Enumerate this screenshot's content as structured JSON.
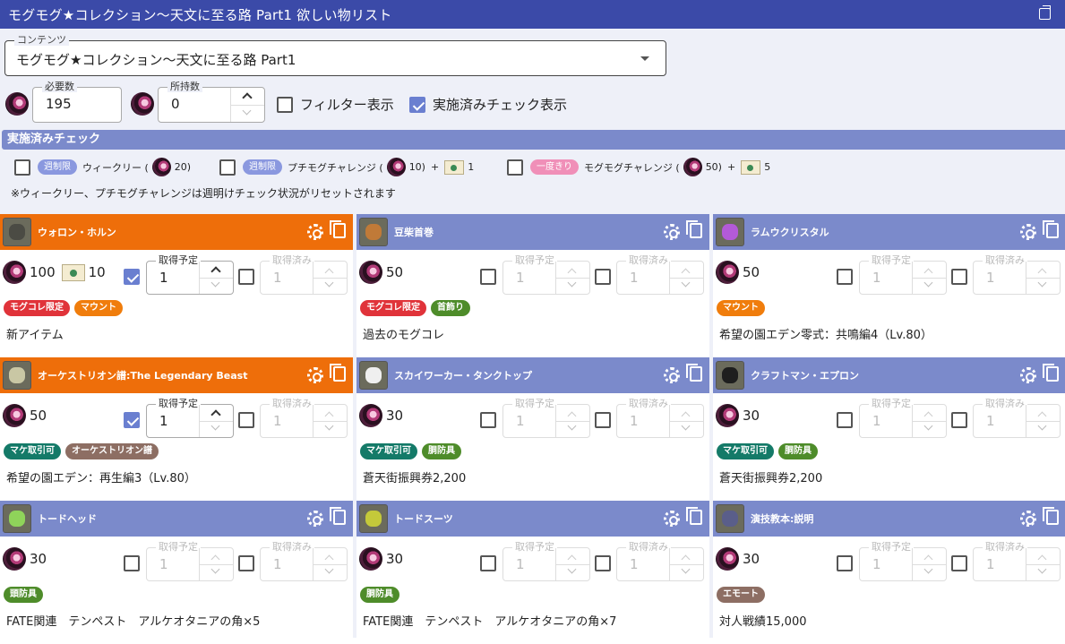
{
  "window": {
    "title": "モグモグ★コレクション～天文に至る路 Part1 欲しい物リスト"
  },
  "content_select": {
    "legend": "コンテンツ",
    "value": "モグモグ★コレクション～天文に至る路 Part1"
  },
  "required": {
    "legend": "必要数",
    "value": "195"
  },
  "owned": {
    "legend": "所持数",
    "value": "0"
  },
  "filter_toggle": {
    "label": "フィルター表示",
    "checked": false
  },
  "done_check_toggle": {
    "label": "実施済みチェック表示",
    "checked": true
  },
  "section_title": "実施済みチェック",
  "checks": [
    {
      "badge": "週制限",
      "label": "ウィークリー (",
      "tokens": "20)",
      "checked": false
    },
    {
      "badge": "週制限",
      "label": "プチモグチャレンジ (",
      "tokens": "10)",
      "plus": "+",
      "mail": "1",
      "checked": false
    },
    {
      "badge": "一度きり",
      "label": "モグモグチャレンジ (",
      "tokens": "50)",
      "plus": "+",
      "mail": "5",
      "checked": false
    }
  ],
  "note": "※ウィークリー、プチモグチャレンジは週明けチェック状況がリセットされます",
  "field_labels": {
    "planned": "取得予定",
    "obtained": "取得済み"
  },
  "items": [
    {
      "name": "ウォロン・ホルン",
      "tokens": "100",
      "mail": "10",
      "planned_checked": true,
      "planned": "1",
      "obtained": "1",
      "tags": [
        "モグコレ限定",
        "マウント"
      ],
      "source": "新アイテム",
      "highlight": true,
      "thumb": "#4b4b44"
    },
    {
      "name": "豆柴首巻",
      "tokens": "50",
      "mail": "",
      "planned_checked": false,
      "planned": "1",
      "obtained": "1",
      "tags": [
        "モグコレ限定",
        "首飾り"
      ],
      "source": "過去のモグコレ",
      "highlight": false,
      "thumb": "#c07a38"
    },
    {
      "name": "ラムウクリスタル",
      "tokens": "50",
      "mail": "",
      "planned_checked": false,
      "planned": "1",
      "obtained": "1",
      "tags": [
        "マウント"
      ],
      "source": "希望の園エデン零式：共鳴編4（Lv.80）",
      "highlight": false,
      "thumb": "#b35ad8"
    },
    {
      "name": "オーケストリオン譜:The Legendary Beast",
      "tokens": "50",
      "mail": "",
      "planned_checked": true,
      "planned": "1",
      "obtained": "1",
      "tags": [
        "マケ取引可",
        "オーケストリオン譜"
      ],
      "source": "希望の園エデン：再生編3（Lv.80）",
      "highlight": true,
      "thumb": "#c9c7a4"
    },
    {
      "name": "スカイワーカー・タンクトップ",
      "tokens": "30",
      "mail": "",
      "planned_checked": false,
      "planned": "1",
      "obtained": "1",
      "tags": [
        "マケ取引可",
        "胴防具"
      ],
      "source": "蒼天街振興券2,200",
      "highlight": false,
      "thumb": "#efefef"
    },
    {
      "name": "クラフトマン・エプロン",
      "tokens": "30",
      "mail": "",
      "planned_checked": false,
      "planned": "1",
      "obtained": "1",
      "tags": [
        "マケ取引可",
        "胴防具"
      ],
      "source": "蒼天街振興券2,200",
      "highlight": false,
      "thumb": "#1e1e1e"
    },
    {
      "name": "トードヘッド",
      "tokens": "30",
      "mail": "",
      "planned_checked": false,
      "planned": "1",
      "obtained": "1",
      "tags": [
        "頭防具"
      ],
      "source": "FATE関連　テンペスト　アルケオタニアの角×5",
      "highlight": false,
      "thumb": "#8fd35a"
    },
    {
      "name": "トードスーツ",
      "tokens": "30",
      "mail": "",
      "planned_checked": false,
      "planned": "1",
      "obtained": "1",
      "tags": [
        "胴防具"
      ],
      "source": "FATE関連　テンペスト　アルケオタニアの角×7",
      "highlight": false,
      "thumb": "#c4c93a"
    },
    {
      "name": "演技教本:説明",
      "tokens": "30",
      "mail": "",
      "planned_checked": false,
      "planned": "1",
      "obtained": "1",
      "tags": [
        "エモート"
      ],
      "source": "対人戦績15,000",
      "highlight": false,
      "thumb": "#5a5e8a"
    }
  ],
  "tag_colors": {
    "モグコレ限定": "red",
    "マウント": "orange",
    "首飾り": "green",
    "マケ取引可": "teal",
    "オーケストリオン譜": "brown",
    "胴防具": "green",
    "頭防具": "green",
    "エモート": "brown"
  }
}
